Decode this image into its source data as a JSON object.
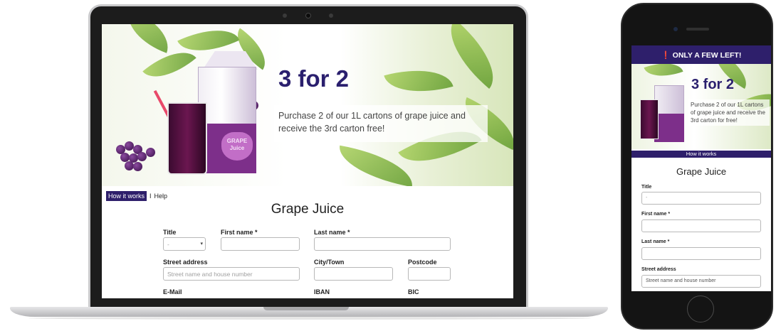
{
  "desktop": {
    "hero": {
      "headline": "3 for 2",
      "text": "Purchase 2 of our 1L cartons of grape juice and receive the 3rd carton free!",
      "carton_label": "GRAPE Juice"
    },
    "nav": {
      "how_it_works": "How it works",
      "separator": "I",
      "help": "Help"
    },
    "page_title": "Grape Juice",
    "form": {
      "title_label": "Title",
      "title_value": "-",
      "first_name_label": "First name *",
      "last_name_label": "Last name *",
      "street_label": "Street address",
      "street_placeholder": "Street name and house number",
      "city_label": "City/Town",
      "postcode_label": "Postcode",
      "email_label": "E-Mail",
      "iban_label": "IBAN",
      "bic_label": "BIC"
    }
  },
  "mobile": {
    "banner": "ONLY A FEW LEFT!",
    "banner_icon": "exclamation-circle-icon",
    "hero": {
      "headline": "3 for 2",
      "text": "Purchase 2 of our 1L cartons of grape juice and receive the 3rd carton for free!"
    },
    "how_it_works": "How it works",
    "page_title": "Grape Juice",
    "form": {
      "title_label": "Title",
      "title_value": "-",
      "first_name_label": "First name *",
      "last_name_label": "Last name *",
      "street_label": "Street address",
      "street_value": "Street name and house number"
    }
  },
  "colors": {
    "brand": "#2e1f6b",
    "headline": "#2a1f6e",
    "grape": "#7d2f8a"
  }
}
